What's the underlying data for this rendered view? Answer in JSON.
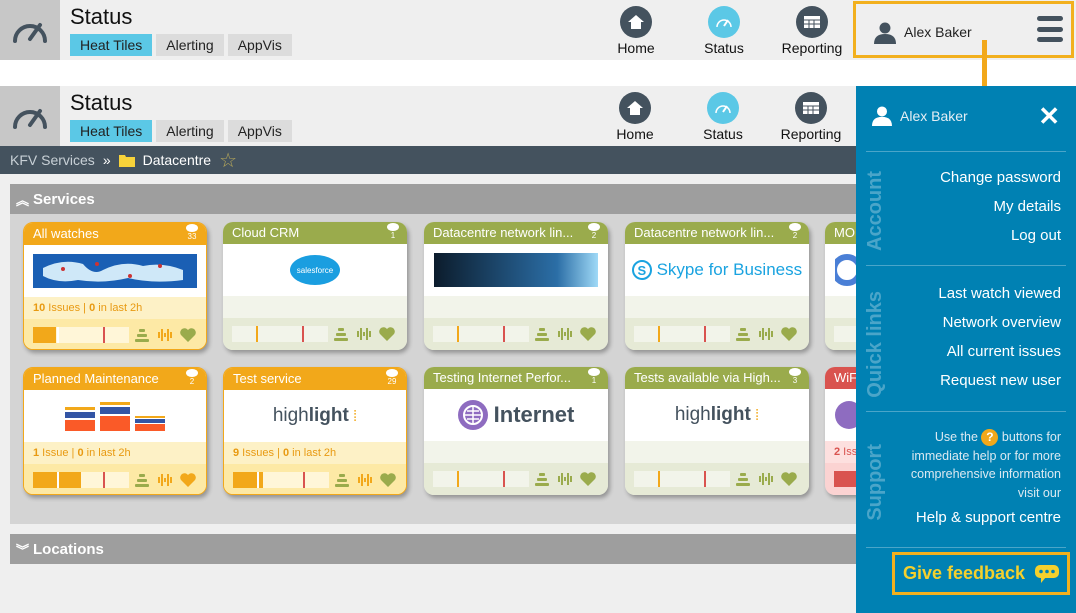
{
  "header": {
    "title": "Status",
    "tabs": [
      {
        "label": "Heat Tiles",
        "active": true
      },
      {
        "label": "Alerting",
        "active": false
      },
      {
        "label": "AppVis",
        "active": false
      }
    ],
    "nav": [
      {
        "label": "Home",
        "icon": "home-icon"
      },
      {
        "label": "Status",
        "icon": "gauge-icon",
        "active": true
      },
      {
        "label": "Reporting",
        "icon": "table-icon"
      }
    ],
    "user_name": "Alex Baker"
  },
  "breadcrumb": {
    "root": "KFV Services",
    "separator": "»",
    "current": "Datacentre"
  },
  "sections": {
    "services": "Services",
    "locations": "Locations"
  },
  "tiles": [
    {
      "title": "All watches",
      "watch_count": "33",
      "status": "orange",
      "logo": "world map",
      "issues_count": "10",
      "issues_label": "Issues",
      "recent": "0",
      "recent_label": "in last 2h",
      "fill_pct": 24
    },
    {
      "title": "Cloud CRM",
      "watch_count": "1",
      "status": "green",
      "logo": "salesforce",
      "issues_text": "",
      "fill_pct": 0
    },
    {
      "title": "Datacentre network lin...",
      "watch_count": "2",
      "status": "green",
      "logo": "network globe",
      "issues_text": "",
      "fill_pct": 0
    },
    {
      "title": "Datacentre network lin...",
      "watch_count": "2",
      "status": "green",
      "logo": "Skype for Business",
      "issues_text": "",
      "fill_pct": 0
    },
    {
      "title": "MO",
      "watch_count": "",
      "status": "green",
      "logo": "partial",
      "issues_text": "",
      "fill_pct": 0
    },
    {
      "title": "Planned Maintenance",
      "watch_count": "2",
      "status": "orange",
      "logo": "stacked bars",
      "issues_count": "1",
      "issues_label": "Issue",
      "recent": "0",
      "recent_label": "in last 2h",
      "fill_pct": 50
    },
    {
      "title": "Test service",
      "watch_count": "29",
      "status": "orange",
      "logo": "highlight",
      "issues_count": "9",
      "issues_label": "Issues",
      "recent": "0",
      "recent_label": "in last 2h",
      "fill_pct": 31
    },
    {
      "title": "Testing Internet Perfor...",
      "watch_count": "1",
      "status": "green",
      "logo": "Internet",
      "issues_text": "",
      "fill_pct": 0
    },
    {
      "title": "Tests available via High...",
      "watch_count": "3",
      "status": "green",
      "logo": "highlight",
      "issues_text": "",
      "fill_pct": 0
    },
    {
      "title": "WiF",
      "watch_count": "",
      "status": "red",
      "logo": "wifi",
      "issues_count": "2",
      "issues_label": "Iss",
      "fill_pct": 100
    }
  ],
  "drawer": {
    "user_name": "Alex Baker",
    "close": "✕",
    "account_label": "Account",
    "account_links": [
      "Change password",
      "My details",
      "Log out"
    ],
    "quicklinks_label": "Quick links",
    "quick_links": [
      "Last watch viewed",
      "Network overview",
      "All current issues",
      "Request new user"
    ],
    "support_label": "Support",
    "support_text_pre": "Use the",
    "support_text_post": "buttons for immediate help or for more comprehensive information visit our",
    "support_link": "Help & support centre",
    "feedback": "Give feedback"
  },
  "colors": {
    "accent": "#5bc8e6",
    "warning": "#f2a81a",
    "ok": "#9aab4c",
    "critical": "#d9534f",
    "drawer": "#0081b3",
    "highlight_box": "#f2b01e"
  }
}
